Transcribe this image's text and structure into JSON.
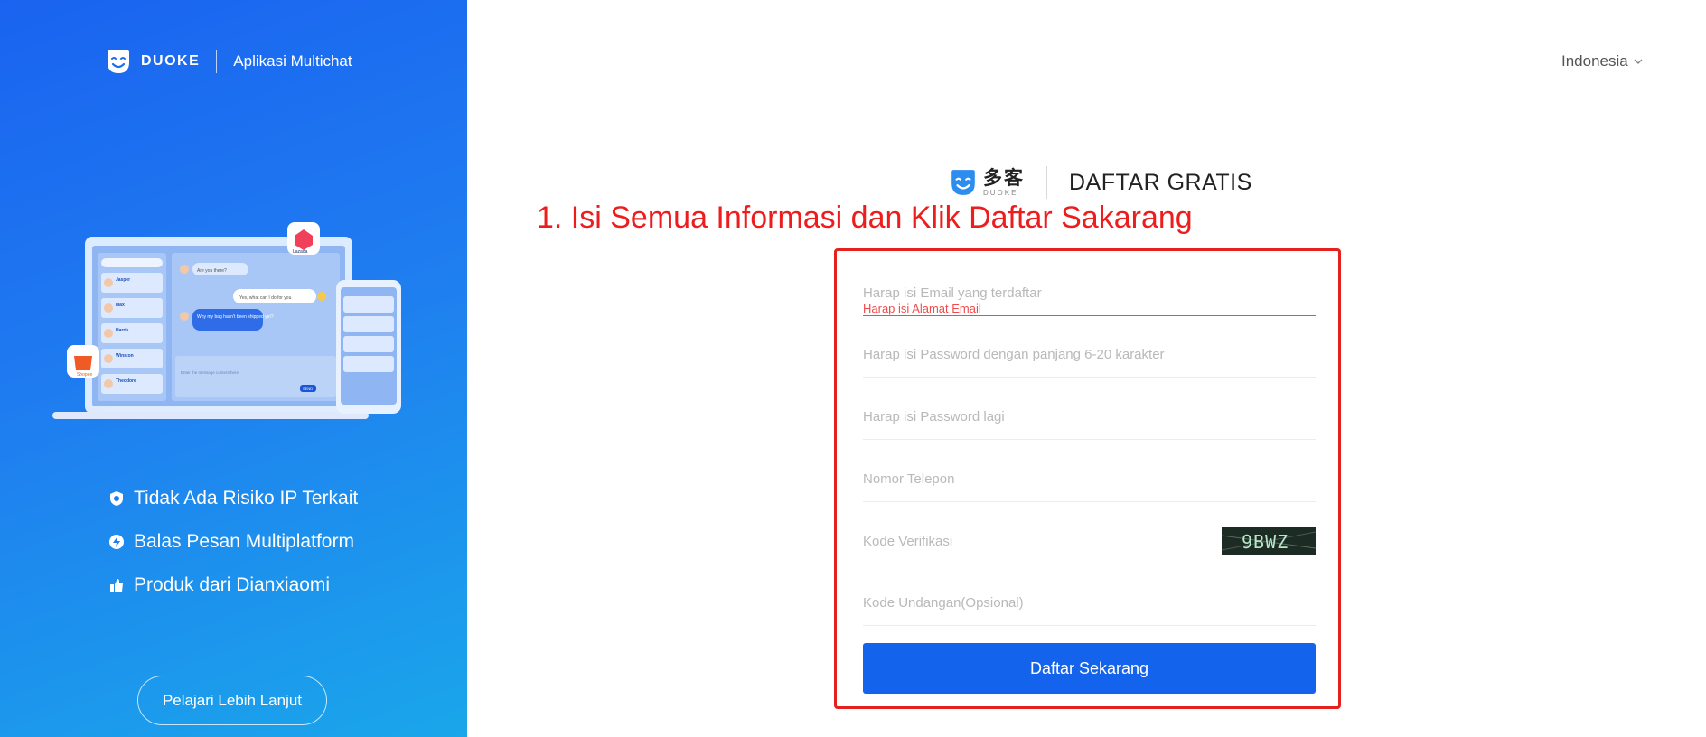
{
  "left_panel": {
    "brand_name": "DUOKE",
    "brand_tagline": "Aplikasi Multichat",
    "features": [
      {
        "label": "Tidak Ada Risiko IP Terkait",
        "icon": "shield-icon"
      },
      {
        "label": "Balas Pesan Multiplatform",
        "icon": "lightning-icon"
      },
      {
        "label": "Produk dari Dianxiaomi",
        "icon": "thumbs-up-icon"
      }
    ],
    "learn_more_label": "Pelajari Lebih Lanjut",
    "illustration": {
      "lazada_label": "Lazada",
      "shopee_label": "Shopee",
      "contacts": [
        "Jasper",
        "Max",
        "Harris",
        "Winston",
        "Theodore"
      ],
      "messages": [
        "Are you there?",
        "Yes, what can I do for you",
        "Why my bag hasn't been shipped yet?"
      ],
      "composer_placeholder": "Enter the message content here",
      "send_label": "SEND"
    }
  },
  "header": {
    "language": "Indonesia"
  },
  "form": {
    "logo_cn": "多客",
    "logo_en": "DUOKE",
    "title": "DAFTAR GRATIS",
    "fields": {
      "email_placeholder": "Harap isi Email yang terdaftar",
      "email_error": "Harap isi Alamat Email",
      "password_placeholder": "Harap isi Password dengan panjang 6-20 karakter",
      "password_confirm_placeholder": "Harap isi Password lagi",
      "phone_placeholder": "Nomor Telepon",
      "verification_placeholder": "Kode Verifikasi",
      "captcha_text": "9BWZ",
      "invite_placeholder": "Kode Undangan(Opsional)"
    },
    "submit_label": "Daftar Sekarang"
  },
  "annotation": {
    "text": "1. Isi Semua Informasi dan Klik Daftar Sakarang",
    "color": "#ee1d1d"
  },
  "colors": {
    "primary": "#1463ec",
    "error": "#f04b4b"
  }
}
